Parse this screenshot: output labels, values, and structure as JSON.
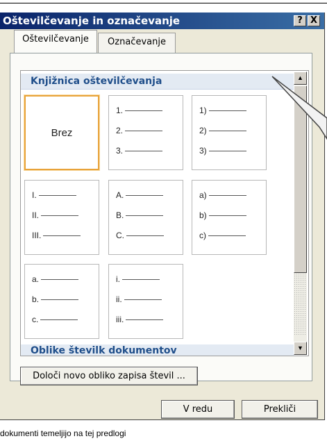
{
  "window": {
    "title": "Oštevilčevanje in označevanje",
    "help_label": "?",
    "close_label": "X"
  },
  "tabs": [
    {
      "label": "Oštevilčevanje",
      "active": true
    },
    {
      "label": "Označevanje",
      "active": false
    }
  ],
  "gallery": {
    "header": "Knjižnica oštevilčevanja",
    "footer": "Oblike številk dokumentov",
    "tiles": [
      {
        "kind": "none",
        "label": "Brez",
        "selected": true
      },
      {
        "kind": "list",
        "items": [
          "1.",
          "2.",
          "3."
        ]
      },
      {
        "kind": "list",
        "items": [
          "1)",
          "2)",
          "3)"
        ]
      },
      {
        "kind": "list",
        "items": [
          "I.",
          "II.",
          "III."
        ]
      },
      {
        "kind": "list",
        "items": [
          "A.",
          "B.",
          "C."
        ]
      },
      {
        "kind": "list",
        "items": [
          "a)",
          "b)",
          "c)"
        ]
      },
      {
        "kind": "list",
        "items": [
          "a.",
          "b.",
          "c."
        ]
      },
      {
        "kind": "list",
        "items": [
          "i.",
          "ii.",
          "iii."
        ]
      }
    ]
  },
  "buttons": {
    "define_new": "Določi novo obliko zapisa števil ...",
    "ok": "V redu",
    "cancel": "Prekliči"
  },
  "status": {
    "text": "dokumenti temeljijo na tej predlogi"
  },
  "colors": {
    "titlebar": "#0a246a",
    "header_text": "#1f4e8a",
    "selected_border": "#e8a33a"
  }
}
